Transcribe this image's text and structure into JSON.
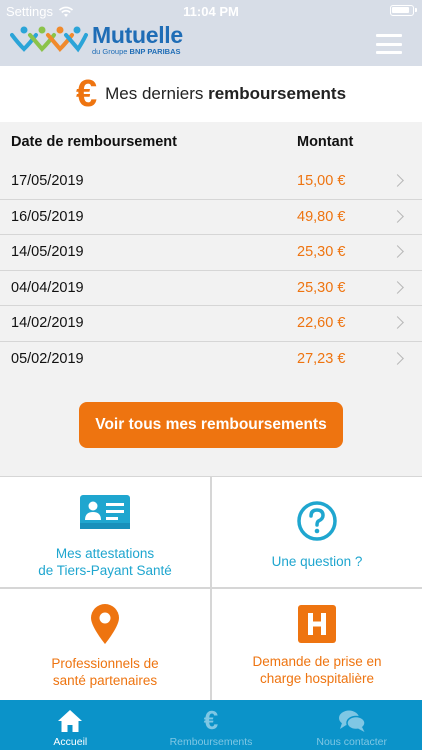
{
  "status_bar": {
    "carrier": "Settings",
    "time": "11:04 PM"
  },
  "header": {
    "logo_name": "Mutuelle",
    "logo_sub_prefix": "du Groupe ",
    "logo_sub_brand": "BNP PARIBAS"
  },
  "section": {
    "title_prefix": "Mes derniers ",
    "title_bold": "remboursements",
    "icon": "euro-icon"
  },
  "table": {
    "headers": {
      "date": "Date de remboursement",
      "amount": "Montant"
    },
    "rows": [
      {
        "date": "17/05/2019",
        "amount": "15,00 €"
      },
      {
        "date": "16/05/2019",
        "amount": "49,80 €"
      },
      {
        "date": "14/05/2019",
        "amount": "25,30 €"
      },
      {
        "date": "04/04/2019",
        "amount": "25,30 €"
      },
      {
        "date": "14/02/2019",
        "amount": "22,60 €"
      },
      {
        "date": "05/02/2019",
        "amount": "27,23 €"
      }
    ]
  },
  "cta": {
    "label": "Voir tous mes remboursements"
  },
  "tiles": [
    {
      "label": "Mes attestations\nde Tiers-Payant Santé",
      "icon": "id-card-icon"
    },
    {
      "label": "Une question ?",
      "icon": "question-icon"
    },
    {
      "label": "Professionnels de\nsanté partenaires",
      "icon": "map-pin-icon"
    },
    {
      "label": "Demande de prise en\ncharge hospitalière",
      "icon": "hospital-icon"
    }
  ],
  "tabbar": [
    {
      "label": "Accueil",
      "icon": "home-icon",
      "active": true
    },
    {
      "label": "Remboursements",
      "icon": "euro-icon",
      "active": false
    },
    {
      "label": "Nous contacter",
      "icon": "chat-icon",
      "active": false
    }
  ],
  "colors": {
    "accent": "#ee7410",
    "primary": "#1fa6cf",
    "tabbar": "#0b93c9",
    "header": "#d7dde7"
  }
}
